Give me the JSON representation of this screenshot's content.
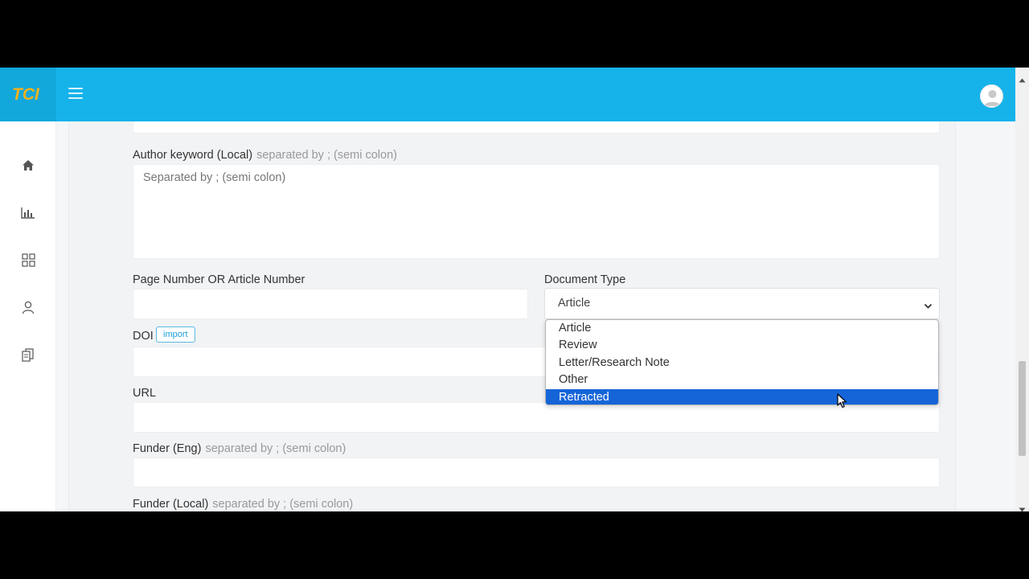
{
  "header": {
    "logo_text": "TCI",
    "brand_color": "#16b3ea",
    "logo_color": "#f2b21e"
  },
  "sidebar": {
    "items": [
      {
        "icon": "home-icon"
      },
      {
        "icon": "bar-chart-icon"
      },
      {
        "icon": "grid-icon"
      },
      {
        "icon": "user-icon"
      },
      {
        "icon": "documents-icon"
      }
    ]
  },
  "form": {
    "author_keyword_local": {
      "label": "Author keyword (Local)",
      "hint": "separated by ; (semi colon)",
      "placeholder": "Separated by ; (semi colon)",
      "value": ""
    },
    "page_number": {
      "label": "Page Number OR Article Number",
      "value": ""
    },
    "document_type": {
      "label": "Document Type",
      "selected": "Article",
      "options": [
        "Article",
        "Review",
        "Letter/Research Note",
        "Other",
        "Retracted"
      ],
      "highlighted": "Retracted"
    },
    "doi": {
      "label": "DOI",
      "import_label": "import",
      "value": ""
    },
    "url": {
      "label": "URL",
      "value": ""
    },
    "funder_eng": {
      "label": "Funder (Eng)",
      "hint": "separated by ; (semi colon)",
      "value": ""
    },
    "funder_local": {
      "label": "Funder (Local)",
      "hint": "separated by ; (semi colon)"
    }
  },
  "colors": {
    "highlight": "#1565d8",
    "import_border": "#5ab9e3"
  }
}
